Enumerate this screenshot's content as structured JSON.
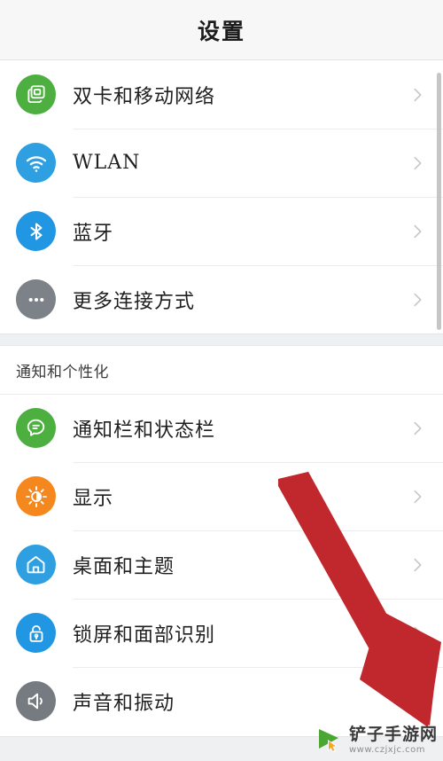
{
  "header": {
    "title": "设置"
  },
  "colors": {
    "page_bg": "#ffffff",
    "header_bg": "#f7f7f7",
    "group_gap": "#eef0f2",
    "divider": "#ececec",
    "arrow_red": "#c0282d",
    "green": "#4caf3f",
    "blue": "#2196e3",
    "light_blue": "#29a8ef",
    "grey": "#757b80",
    "orange": "#f5871f"
  },
  "groups": [
    {
      "name": "connectivity",
      "section_label": null,
      "items": [
        {
          "label": "双卡和移动网络",
          "icon": "sim-cards-icon",
          "icon_color": "#4caf3f",
          "chevron": "chevron-right-icon"
        },
        {
          "label": "WLAN",
          "icon": "wifi-icon",
          "icon_color": "#2e9fe0",
          "chevron": "chevron-right-icon"
        },
        {
          "label": "蓝牙",
          "icon": "bluetooth-icon",
          "icon_color": "#2196e3",
          "chevron": "chevron-right-icon"
        },
        {
          "label": "更多连接方式",
          "icon": "ellipsis-icon",
          "icon_color": "#7c8287",
          "chevron": "chevron-right-icon"
        }
      ]
    },
    {
      "name": "notifications-personalization",
      "section_label": "通知和个性化",
      "items": [
        {
          "label": "通知栏和状态栏",
          "icon": "speech-bubble-icon",
          "icon_color": "#4caf3f",
          "chevron": "chevron-right-icon"
        },
        {
          "label": "显示",
          "icon": "brightness-icon",
          "icon_color": "#f5871f",
          "chevron": "chevron-right-icon"
        },
        {
          "label": "桌面和主题",
          "icon": "home-icon",
          "icon_color": "#2e9fe0",
          "chevron": "chevron-right-icon"
        },
        {
          "label": "锁屏和面部识别",
          "icon": "lock-open-icon",
          "icon_color": "#2196e3",
          "chevron": "chevron-right-icon"
        },
        {
          "label": "声音和振动",
          "icon": "speaker-icon",
          "icon_color": "#757b80",
          "chevron": "chevron-right-icon"
        }
      ]
    }
  ],
  "annotation": {
    "arrow": "red-down-right-arrow"
  },
  "watermark": {
    "name": "铲子手游网",
    "url": "www.czjxjc.com",
    "logo": "cursor-play-logo"
  }
}
